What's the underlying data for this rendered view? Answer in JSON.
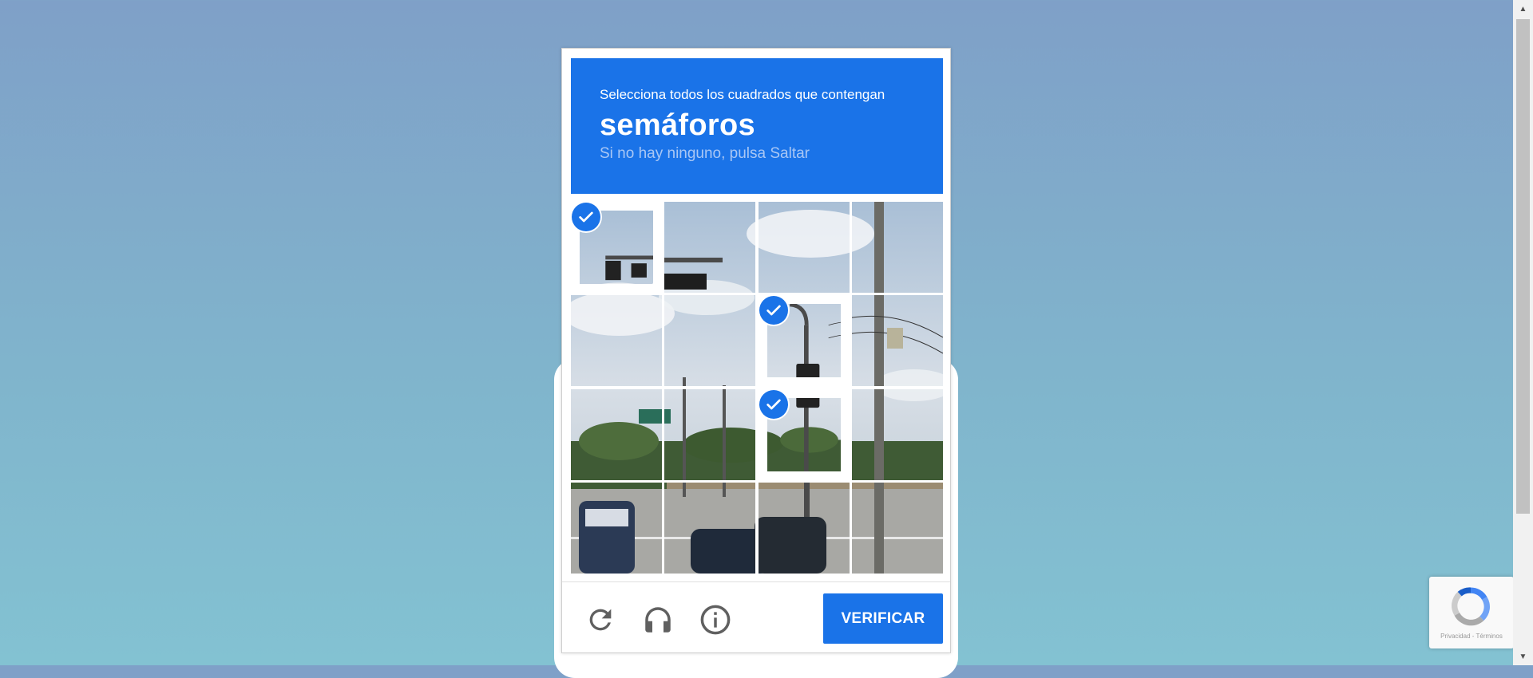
{
  "challenge": {
    "instruction": "Selecciona todos los cuadrados que contengan",
    "keyword": "semáforos",
    "hint": "Si no hay ninguno, pulsa Saltar"
  },
  "grid": {
    "rows": 4,
    "cols": 4,
    "selected_tiles": [
      0,
      6,
      10
    ]
  },
  "footer": {
    "reload_icon": "reload-icon",
    "audio_icon": "headphones-icon",
    "info_icon": "info-icon",
    "verify_label": "VERIFICAR"
  },
  "badge": {
    "text": "Privacidad - Términos"
  },
  "colors": {
    "accent": "#1a73e8",
    "hint": "#a9c7f5"
  }
}
